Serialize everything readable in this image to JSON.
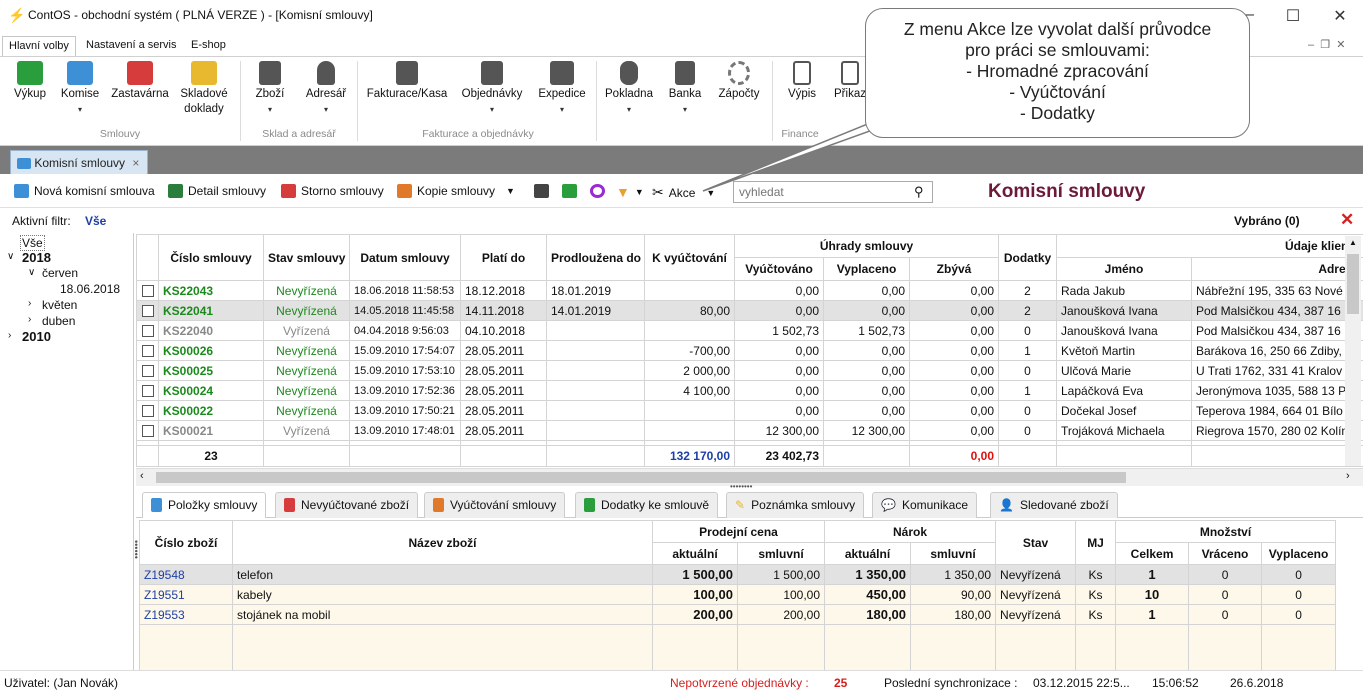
{
  "window": {
    "title": "ContOS - obchodní systém   ( PLNÁ VERZE ) - [Komisní smlouvy]"
  },
  "menu_tabs": [
    "Hlavní volby",
    "Nastavení a servis",
    "E-shop"
  ],
  "ribbon": {
    "buttons": [
      {
        "label": "Výkup",
        "color": "#2a9d3c"
      },
      {
        "label": "Komise",
        "color": "#3d8fd6"
      },
      {
        "label": "Zastavárna",
        "color": "#d63c3c"
      },
      {
        "label": "Skladové doklady",
        "color": "#e8b82e"
      },
      {
        "label": "Zboží"
      },
      {
        "label": "Adresář"
      },
      {
        "label": "Fakturace/Kasa"
      },
      {
        "label": "Objednávky"
      },
      {
        "label": "Expedice"
      },
      {
        "label": "Pokladna"
      },
      {
        "label": "Banka"
      },
      {
        "label": "Zápočty"
      },
      {
        "label": "Výpis"
      },
      {
        "label": "Přikaz"
      }
    ],
    "groups": [
      "Smlouvy",
      "Sklad a adresář",
      "Fakturace a objednávky",
      "Finance"
    ]
  },
  "doc_tab": "Komisní smlouvy",
  "toolbar": {
    "new": "Nová komisní smlouva",
    "detail": "Detail smlouvy",
    "storno": "Storno smlouvy",
    "copy": "Kopie smlouvy",
    "akce": "Akce",
    "search_placeholder": "vyhledat",
    "title": "Komisní smlouvy"
  },
  "filter": {
    "label": "Aktivní filtr:",
    "value": "Vše",
    "selected": "Vybráno (0)"
  },
  "tree": {
    "all": "Vše",
    "y2018": "2018",
    "cerven": "červen",
    "d1": "18.06.2018",
    "kveten": "květen",
    "duben": "duben",
    "y2010": "2010"
  },
  "grid": {
    "headers": {
      "cislo": "Číslo smlouvy",
      "stav": "Stav smlouvy",
      "datum": "Datum smlouvy",
      "plati": "Platí do",
      "prodl": "Prodloužena do",
      "kvyuc": "K vyúčtování",
      "uhrady": "Úhrady smlouvy",
      "vyuc": "Vyúčtováno",
      "vypl": "Vyplaceno",
      "zbyva": "Zbývá",
      "dodatky": "Dodatky",
      "klient": "Údaje klienta",
      "jmeno": "Jméno",
      "adresa": "Adresa"
    },
    "rows": [
      {
        "cislo": "KS22043",
        "stav": "Nevyřízená",
        "datum": "18.06.2018 11:58:53",
        "plati": "18.12.2018",
        "prodl": "18.01.2019",
        "kvyuc": "",
        "vyuc": "0,00",
        "vypl": "0,00",
        "zbyva": "0,00",
        "dod": "2",
        "jmeno": "Rada Jakub",
        "adresa": "Nábřežní 195, 335 63 Nové"
      },
      {
        "cislo": "KS22041",
        "stav": "Nevyřízená",
        "datum": "14.05.2018 11:45:58",
        "plati": "14.11.2018",
        "prodl": "14.01.2019",
        "kvyuc": "80,00",
        "vyuc": "0,00",
        "vypl": "0,00",
        "zbyva": "0,00",
        "dod": "2",
        "jmeno": "Janoušková Ivana",
        "adresa": "Pod Malsičkou 434, 387 16"
      },
      {
        "cislo": "KS22040",
        "stav": "Vyřízená",
        "datum": "04.04.2018 9:56:03",
        "plati": "04.10.2018",
        "prodl": "",
        "kvyuc": "",
        "vyuc": "1 502,73",
        "vypl": "1 502,73",
        "zbyva": "0,00",
        "dod": "0",
        "jmeno": "Janoušková Ivana",
        "adresa": "Pod Malsičkou 434, 387 16"
      },
      {
        "cislo": "KS00026",
        "stav": "Nevyřízená",
        "datum": "15.09.2010 17:54:07",
        "plati": "28.05.2011",
        "prodl": "",
        "kvyuc": "-700,00",
        "vyuc": "0,00",
        "vypl": "0,00",
        "zbyva": "0,00",
        "dod": "1",
        "jmeno": "Květoň Martin",
        "adresa": "Barákova 16, 250 66 Zdiby,"
      },
      {
        "cislo": "KS00025",
        "stav": "Nevyřízená",
        "datum": "15.09.2010 17:53:10",
        "plati": "28.05.2011",
        "prodl": "",
        "kvyuc": "2 000,00",
        "vyuc": "0,00",
        "vypl": "0,00",
        "zbyva": "0,00",
        "dod": "0",
        "jmeno": "Ulčová Marie",
        "adresa": "U Trati 1762, 331 41 Kralov"
      },
      {
        "cislo": "KS00024",
        "stav": "Nevyřízená",
        "datum": "13.09.2010 17:52:36",
        "plati": "28.05.2011",
        "prodl": "",
        "kvyuc": "4 100,00",
        "vyuc": "0,00",
        "vypl": "0,00",
        "zbyva": "0,00",
        "dod": "1",
        "jmeno": "Lapáčková Eva",
        "adresa": "Jeronýmova 1035, 588 13 P"
      },
      {
        "cislo": "KS00022",
        "stav": "Nevyřízená",
        "datum": "13.09.2010 17:50:21",
        "plati": "28.05.2011",
        "prodl": "",
        "kvyuc": "",
        "vyuc": "0,00",
        "vypl": "0,00",
        "zbyva": "0,00",
        "dod": "0",
        "jmeno": "Dočekal Josef",
        "adresa": "Teperova 1984, 664 01 Bílo"
      },
      {
        "cislo": "KS00021",
        "stav": "Vyřízená",
        "datum": "13.09.2010 17:48:01",
        "plati": "28.05.2011",
        "prodl": "",
        "kvyuc": "",
        "vyuc": "12 300,00",
        "vypl": "12 300,00",
        "zbyva": "0,00",
        "dod": "0",
        "jmeno": "Trojáková Michaela",
        "adresa": "Riegrova 1570, 280 02 Kolín"
      }
    ],
    "footer": {
      "count": "23",
      "kvyuc": "132 170,00",
      "vyuc": "23 402,73",
      "zbyva": "0,00"
    }
  },
  "bottom_tabs": [
    "Položky smlouvy",
    "Nevyúčtované zboží",
    "Vyúčtování smlouvy",
    "Dodatky ke smlouvě",
    "Poznámka smlouvy",
    "Komunikace",
    "Sledované zboží"
  ],
  "items": {
    "headers": {
      "cislo": "Číslo zboží",
      "nazev": "Název zboží",
      "prodej": "Prodejní cena",
      "narok": "Nárok",
      "aktualni": "aktuální",
      "smluvni": "smluvní",
      "stav": "Stav",
      "mj": "MJ",
      "mnozstvi": "Množství",
      "celkem": "Celkem",
      "vraceno": "Vráceno",
      "vyplaceno": "Vyplaceno"
    },
    "rows": [
      {
        "cislo": "Z19548",
        "nazev": "telefon",
        "pa": "1 500,00",
        "ps": "1 500,00",
        "na": "1 350,00",
        "ns": "1 350,00",
        "stav": "Nevyřízená",
        "mj": "Ks",
        "celkem": "1",
        "vraceno": "0",
        "vypl": "0"
      },
      {
        "cislo": "Z19551",
        "nazev": "kabely",
        "pa": "100,00",
        "ps": "100,00",
        "na": "450,00",
        "ns": "90,00",
        "stav": "Nevyřízená",
        "mj": "Ks",
        "celkem": "10",
        "vraceno": "0",
        "vypl": "0"
      },
      {
        "cislo": "Z19553",
        "nazev": "stojánek na mobil",
        "pa": "200,00",
        "ps": "200,00",
        "na": "180,00",
        "ns": "180,00",
        "stav": "Nevyřízená",
        "mj": "Ks",
        "celkem": "1",
        "vraceno": "0",
        "vypl": "0"
      }
    ]
  },
  "status": {
    "user": "Uživatel: (Jan Novák)",
    "unconfirmed_label": "Nepotvrzené objednávky :",
    "unconfirmed_count": "25",
    "sync_label": "Poslední synchronizace :",
    "sync_date": "03.12.2015 22:5...",
    "time": "15:06:52",
    "date": "26.6.2018"
  },
  "callout": {
    "lines": [
      "Z menu Akce lze vyvolat další průvodce",
      "pro práci se smlouvami:",
      "- Hromadné zpracování",
      "- Vyúčtování",
      "- Dodatky"
    ]
  }
}
